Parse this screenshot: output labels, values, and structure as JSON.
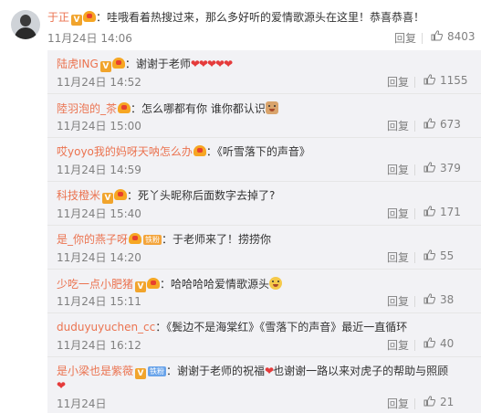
{
  "colors": {
    "username": "#eb7350",
    "heart": "#e53b3b",
    "meta": "#808080",
    "panel": "#f2f2f5"
  },
  "main_comment": {
    "username": "于正",
    "badge": "V",
    "text": "哇哦看着热搜过来，那么多好听的爱情歌源头在这里！恭喜恭喜！",
    "time": "11月24日 14:06",
    "reply_label": "回复",
    "likes": "8403",
    "icons": [
      "avatar",
      "verified-v-icon",
      "vip-crown-icon",
      "thumb-up-icon"
    ]
  },
  "replies": [
    {
      "username": "陆虎ING",
      "verified": "V",
      "vip": true,
      "fan_badge": "",
      "colon": "：",
      "text": "谢谢于老师",
      "hearts": "❤❤❤❤❤",
      "emoji": "",
      "time": "11月24日 14:52",
      "reply_label": "回复",
      "likes": "1155"
    },
    {
      "username": "陸羽泡的_茶",
      "verified": "",
      "vip": true,
      "fan_badge": "",
      "colon": "：",
      "text": "怎么哪都有你 谁你都认识",
      "hearts": "",
      "emoji": "doge-face-icon",
      "time": "11月24日 15:00",
      "reply_label": "回复",
      "likes": "673"
    },
    {
      "username": "哎yoyo我的妈呀天呐怎么办",
      "verified": "",
      "vip": true,
      "fan_badge": "",
      "colon": "：",
      "text": "《听雪落下的声音》",
      "hearts": "",
      "emoji": "",
      "time": "11月24日 14:59",
      "reply_label": "回复",
      "likes": "379"
    },
    {
      "username": "科技橙米",
      "verified": "V",
      "vip": true,
      "fan_badge": "",
      "colon": "：",
      "text": "死丫头昵称后面数字去掉了?",
      "hearts": "",
      "emoji": "",
      "time": "11月24日 15:40",
      "reply_label": "回复",
      "likes": "171"
    },
    {
      "username": "是_你的燕子呀",
      "verified": "",
      "vip": true,
      "fan_badge": "铁粉",
      "colon": "：",
      "text": "于老师来了！捞捞你",
      "hearts": "",
      "emoji": "",
      "time": "11月24日 14:20",
      "reply_label": "回复",
      "likes": "55"
    },
    {
      "username": "少吃一点小肥猪",
      "verified": "V",
      "vip": true,
      "fan_badge": "",
      "colon": "：",
      "text": "哈哈哈哈爱情歌源头",
      "hearts": "",
      "emoji": "laugh-cry-icon",
      "time": "11月24日 15:11",
      "reply_label": "回复",
      "likes": "38"
    },
    {
      "username": "duduyuyuchen_cc",
      "verified": "",
      "vip": false,
      "fan_badge": "",
      "colon": "：",
      "text": "《鬓边不是海棠红》《雪落下的声音》最近一直循环",
      "hearts": "",
      "emoji": "",
      "time": "11月24日 16:12",
      "reply_label": "回复",
      "likes": "40"
    },
    {
      "username": "是小梁也是紫薇",
      "verified": "V",
      "vip": false,
      "fan_badge": "铁粉",
      "colon": "：",
      "text": "谢谢于老师的祝福",
      "hearts": "❤",
      "emoji": "",
      "text2": "也谢谢一路以来对虎子的帮助与照顾",
      "hearts2": "❤",
      "time": "11月24日",
      "reply_label": "回复",
      "likes": "21"
    }
  ]
}
